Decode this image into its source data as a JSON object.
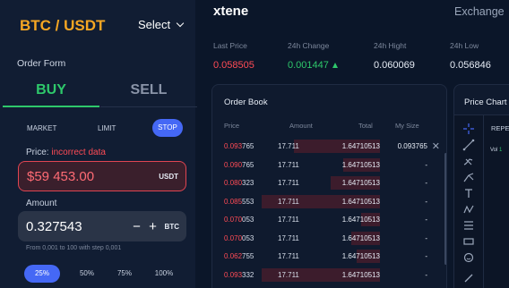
{
  "pair": "BTC / USDT",
  "select_label": "Select",
  "order_form": {
    "title": "Order Form",
    "side_tabs": {
      "buy": "BUY",
      "sell": "SELL"
    },
    "order_types": {
      "market": "MARKET",
      "limit": "LIMIT",
      "stop": "STOP"
    },
    "price_label": "Price:",
    "price_error": "incorrect data",
    "price_value": "$59 453.00",
    "price_currency": "USDT",
    "amount_label": "Amount",
    "amount_value": "0.327543",
    "amount_currency": "BTC",
    "minus": "−",
    "plus": "+",
    "hint": "From 0,001 to 100 with step 0,001",
    "percents": [
      "25%",
      "50%",
      "75%",
      "100%"
    ]
  },
  "header": {
    "logo": "xtene",
    "exchange": "Exchange",
    "stats": [
      {
        "label": "Last Price",
        "value": "0.058505"
      },
      {
        "label": "24h Change",
        "value": "0.001447"
      },
      {
        "label": "24h Hight",
        "value": "0.060069"
      },
      {
        "label": "24h Low",
        "value": "0.056846"
      }
    ]
  },
  "order_book": {
    "title": "Order Book",
    "columns": {
      "price": "Price",
      "amount": "Amount",
      "total": "Total",
      "my_size": "My Size"
    },
    "rows": [
      {
        "price_a": "0.093",
        "price_b": "765",
        "amount": "17.711",
        "total": "1.64710513",
        "my_size": "0.093765",
        "depth": 0.73
      },
      {
        "price_a": "0.090",
        "price_b": "765",
        "amount": "17.711",
        "total": "1.64710513",
        "my_size": "-",
        "depth": 0.31
      },
      {
        "price_a": "0.080",
        "price_b": "323",
        "amount": "17.711",
        "total": "1.64710513",
        "my_size": "-",
        "depth": 0.42
      },
      {
        "price_a": "0.085",
        "price_b": "553",
        "amount": "17.711",
        "total": "1.64710513",
        "my_size": "-",
        "depth": 1.0
      },
      {
        "price_a": "0.070",
        "price_b": "053",
        "amount": "17.711",
        "total": "1.64710513",
        "my_size": "-",
        "depth": 0.16
      },
      {
        "price_a": "0.070",
        "price_b": "053",
        "amount": "17.711",
        "total": "1.64710513",
        "my_size": "-",
        "depth": 0.24
      },
      {
        "price_a": "0.062",
        "price_b": "755",
        "amount": "17.711",
        "total": "1.64710513",
        "my_size": "-",
        "depth": 0.2
      },
      {
        "price_a": "0.093",
        "price_b": "332",
        "amount": "17.711",
        "total": "1.64710513",
        "my_size": "-",
        "depth": 1.0
      }
    ]
  },
  "price_chart": {
    "title": "Price Chart",
    "symbol": "REPE",
    "vol_label": "Vol",
    "vol_value": "1"
  },
  "colors": {
    "accent": "#4568f5",
    "buy": "#2ec86b",
    "sell": "#ff4b55",
    "pair": "#f5a623"
  }
}
